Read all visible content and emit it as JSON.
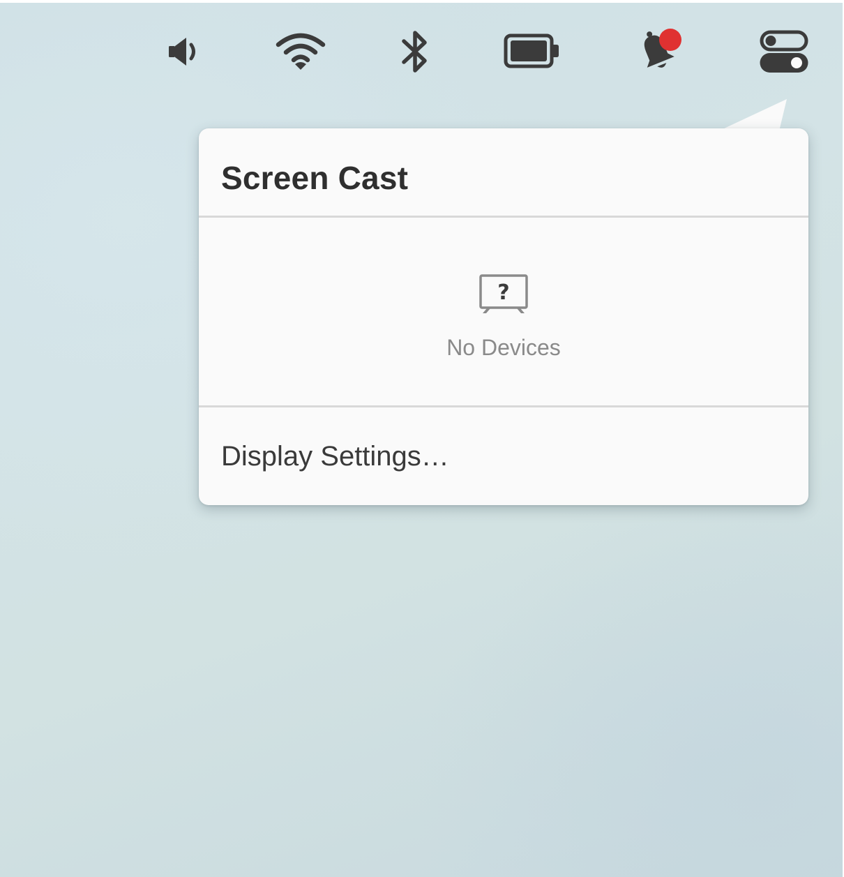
{
  "menubar": {
    "icons": [
      {
        "name": "volume-icon"
      },
      {
        "name": "wifi-icon"
      },
      {
        "name": "bluetooth-icon"
      },
      {
        "name": "battery-icon"
      },
      {
        "name": "notification-bell-icon",
        "badge_color": "#e03131"
      },
      {
        "name": "control-center-toggles-icon"
      }
    ]
  },
  "popover": {
    "title": "Screen Cast",
    "empty_state": {
      "icon": "tv-question-icon",
      "message": "No Devices"
    },
    "footer_item": "Display Settings…"
  },
  "colors": {
    "icon": "#3b3b3b",
    "badge": "#e03131",
    "title_text": "#2f2f2f",
    "muted_text": "#8a8a8a",
    "divider": "#d8d8d8",
    "panel": "#fafafa"
  }
}
